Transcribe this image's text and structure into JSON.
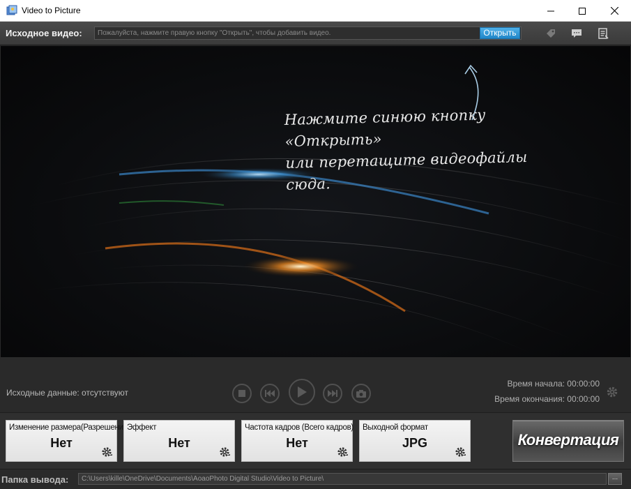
{
  "window": {
    "title": "Video to Picture",
    "icons": {
      "app": "app-icon",
      "minimize": "minimize-icon",
      "maximize": "maximize-icon",
      "close": "close-icon"
    }
  },
  "source": {
    "label": "Исходное видео:",
    "placeholder": "Пожалуйста, нажмите правую кнопку \"Открыть\", чтобы добавить видео.",
    "open_label": "Открыть",
    "tools": [
      "tag-icon",
      "comment-icon",
      "list-icon"
    ]
  },
  "preview": {
    "hint_line1": "Нажмите синюю кнопку «Открыть»",
    "hint_line2": "или перетащите видеофайлы сюда."
  },
  "controls": {
    "source_info": "Исходные данные: отсутствуют",
    "buttons": [
      "stop-icon",
      "previous-icon",
      "play-icon",
      "next-icon",
      "snapshot-icon"
    ],
    "start_time": "Время начала: 00:00:00",
    "end_time": "Время окончания: 00:00:00"
  },
  "settings": {
    "cards": [
      {
        "label": "Изменение размера(Разрешение)",
        "value": "Нет"
      },
      {
        "label": "Эффект",
        "value": "Нет"
      },
      {
        "label": "Частота кадров (Всего кадров)",
        "value": "Нет"
      },
      {
        "label": "Выходной формат",
        "value": "JPG"
      }
    ],
    "convert_label": "Конвертация"
  },
  "output": {
    "label": "Папка вывода:",
    "path": "C:\\Users\\kille\\OneDrive\\Documents\\AoaoPhoto Digital Studio\\Video to Picture\\",
    "browse_label": "..."
  },
  "colors": {
    "accent_blue": "#2f9ad8",
    "background": "#2a2a2a",
    "preview_bg": "#0b0c0e"
  }
}
